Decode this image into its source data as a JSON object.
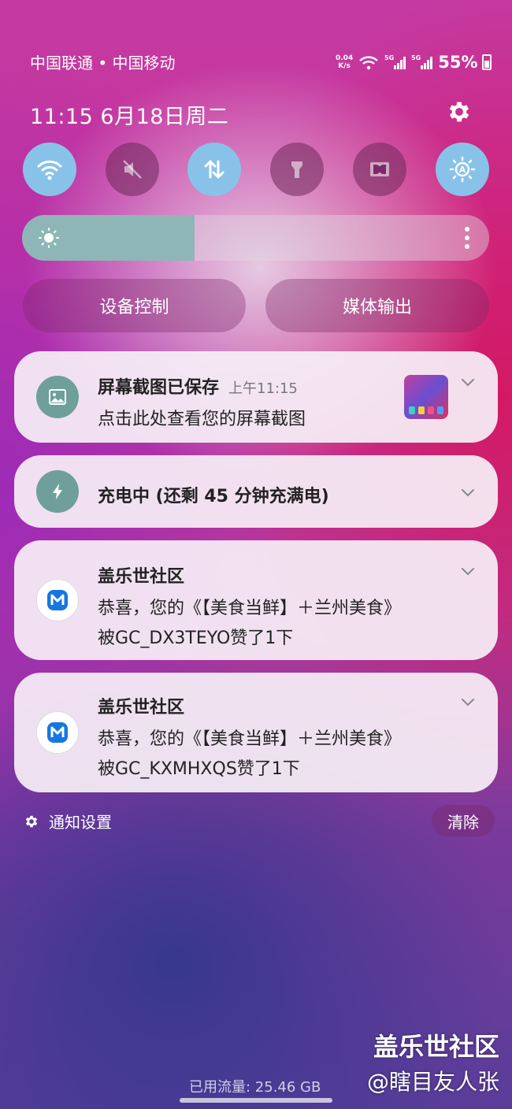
{
  "status_bar": {
    "carriers": "中国联通 • 中国移动",
    "net_speed_value": "0.04",
    "net_speed_unit": "K/s",
    "battery_percent": "55%"
  },
  "header": {
    "datetime": "11:15  6月18日周二"
  },
  "quick_settings": {
    "toggles": [
      {
        "name": "wifi",
        "icon": "wifi-icon",
        "state": "on"
      },
      {
        "name": "sound",
        "icon": "mute-icon",
        "state": "off"
      },
      {
        "name": "mobile-data",
        "icon": "data-arrows-icon",
        "state": "on"
      },
      {
        "name": "flashlight",
        "icon": "flashlight-icon",
        "state": "off"
      },
      {
        "name": "dolby",
        "icon": "dolby-icon",
        "state": "off"
      },
      {
        "name": "auto-brightness",
        "icon": "auto-brightness-icon",
        "state": "on"
      }
    ],
    "brightness_level": 0.37,
    "device_control_label": "设备控制",
    "media_output_label": "媒体输出"
  },
  "notifications": [
    {
      "icon": "image-icon",
      "title": "屏幕截图已保存",
      "time": "上午11:15",
      "lines": [
        "点击此处查看您的屏幕截图"
      ]
    },
    {
      "icon": "charging-icon",
      "title": "充电中 (还剩 45 分钟充满电)",
      "time": "",
      "lines": []
    },
    {
      "icon": "app-logo-icon",
      "title": "盖乐世社区",
      "time": "",
      "lines": [
        "恭喜，您的《【美食当鲜】＋兰州美食》",
        "被GC_DX3TEYO赞了1下"
      ]
    },
    {
      "icon": "app-logo-icon",
      "title": "盖乐世社区",
      "time": "",
      "lines": [
        "恭喜，您的《【美食当鲜】＋兰州美食》",
        "被GC_KXMHXQS赞了1下"
      ]
    }
  ],
  "footer": {
    "notification_settings_label": "通知设置",
    "clear_label": "清除",
    "data_usage": "已用流量: 25.46 GB"
  },
  "watermark": {
    "line1": "盖乐世社区",
    "line2": "@瞎目友人张"
  },
  "colors": {
    "toggle_on": "#89c2e8",
    "brightness_fill": "#8fb6b6",
    "card_bg": "#f6eef6"
  }
}
